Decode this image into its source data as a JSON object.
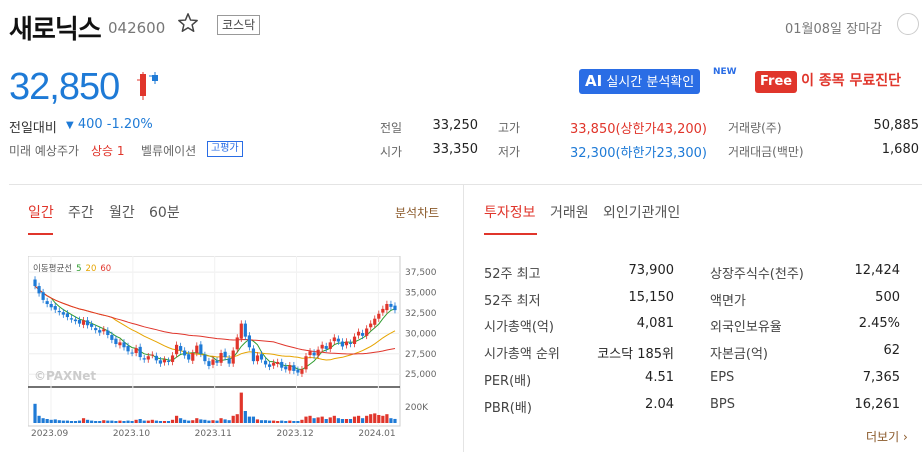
{
  "header": {
    "stock_name": "새로닉스",
    "stock_code": "042600",
    "market": "코스닥",
    "update_time": "01월08일 장마감"
  },
  "price": {
    "current": "32,850",
    "change_label": "전일대비",
    "change_arrow": "▼",
    "change_value": "400 -1.20%",
    "forecast_label": "미래 예상주가",
    "forecast_value": "상승 1",
    "valuation_label": "벨류에이션",
    "valuation_badge": "고평가"
  },
  "promos": {
    "ai_prefix": "AI",
    "ai_label": "실시간 분석확인",
    "ai_new": "NEW",
    "free_badge": "Free",
    "free_label": "이 종목 무료진단"
  },
  "quote": {
    "prev_label": "전일",
    "prev_value": "33,250",
    "open_label": "시가",
    "open_value": "33,350",
    "high_label": "고가",
    "high_value": "33,850(상한가43,200)",
    "low_label": "저가",
    "low_value": "32,300(하한가23,300)",
    "volume_label": "거래량(주)",
    "volume_value": "50,885",
    "amount_label": "거래대금(백만)",
    "amount_value": "1,680"
  },
  "chart_tabs": {
    "items": [
      "일간",
      "주간",
      "월간",
      "60분"
    ],
    "active": "일간",
    "analysis_link": "분석차트"
  },
  "info_tabs": {
    "items": [
      "투자정보",
      "거래원",
      "외인기관개인"
    ],
    "active": "투자정보"
  },
  "invest_info": {
    "left": [
      {
        "label": "52주 최고",
        "value": "73,900"
      },
      {
        "label": "52주 최저",
        "value": "15,150"
      },
      {
        "label": "시가총액(억)",
        "value": "4,081"
      },
      {
        "label": "시가총액 순위",
        "value": "코스닥 185위"
      },
      {
        "label": "PER(배)",
        "value": "4.51"
      },
      {
        "label": "PBR(배)",
        "value": "2.04"
      }
    ],
    "right": [
      {
        "label": "상장주식수(천주)",
        "value": "12,424"
      },
      {
        "label": "액면가",
        "value": "500"
      },
      {
        "label": "외국인보유율",
        "value": "2.45%"
      },
      {
        "label": "자본금(억)",
        "value": "62"
      },
      {
        "label": "EPS",
        "value": "7,365"
      },
      {
        "label": "BPS",
        "value": "16,261"
      }
    ],
    "more_link": "더보기"
  },
  "chart_data": {
    "type": "candlestick",
    "legend_title": "이동평균선",
    "ma_periods": [
      "5",
      "20",
      "60"
    ],
    "ma_colors": {
      "5": "#2e9c2e",
      "20": "#e6a400",
      "60": "#e0352b"
    },
    "up_color": "#e0352b",
    "down_color": "#1e7ad6",
    "watermark": "©PAXNet",
    "x_ticks": [
      "2023.09",
      "2023.10",
      "2023.11",
      "2023.12",
      "2024.01"
    ],
    "y_ticks": [
      "37,500",
      "35,000",
      "32,500",
      "30,000",
      "27,500",
      "25,000"
    ],
    "y_tick_values": [
      37500,
      35000,
      32500,
      30000,
      27500,
      25000
    ],
    "ylim": [
      23800,
      38500
    ],
    "volume_tick": "200K",
    "volume_tick_value": 200000,
    "volume_max": 400000,
    "close": [
      35800,
      34900,
      34100,
      33600,
      33200,
      32900,
      32600,
      32300,
      32000,
      31700,
      31500,
      31200,
      31600,
      31000,
      30800,
      30400,
      30100,
      30500,
      29800,
      29200,
      28700,
      28900,
      28300,
      27800,
      27600,
      28200,
      27100,
      26800,
      27200,
      27400,
      26700,
      26300,
      26800,
      26500,
      27300,
      28600,
      27900,
      27300,
      26800,
      27600,
      28500,
      27500,
      26600,
      26000,
      26800,
      26400,
      27600,
      27100,
      26300,
      27900,
      29500,
      31200,
      29600,
      28300,
      26600,
      27300,
      26800,
      26200,
      25900,
      26400,
      26500,
      25800,
      25600,
      26100,
      25400,
      25200,
      25600,
      27200,
      27800,
      27300,
      28000,
      28600,
      28100,
      28900,
      29500,
      29000,
      28400,
      29000,
      28700,
      29600,
      30200,
      29700,
      30600,
      31200,
      31800,
      32400,
      33000,
      33600,
      33250,
      32850
    ],
    "volume": [
      240000,
      90000,
      60000,
      50000,
      40000,
      45000,
      35000,
      30000,
      30000,
      25000,
      25000,
      30000,
      60000,
      40000,
      30000,
      25000,
      25000,
      35000,
      30000,
      30000,
      25000,
      30000,
      25000,
      30000,
      25000,
      40000,
      50000,
      30000,
      30000,
      40000,
      30000,
      25000,
      25000,
      25000,
      40000,
      90000,
      60000,
      40000,
      30000,
      35000,
      60000,
      45000,
      40000,
      30000,
      35000,
      30000,
      60000,
      45000,
      35000,
      90000,
      110000,
      380000,
      150000,
      80000,
      80000,
      45000,
      35000,
      35000,
      30000,
      30000,
      25000,
      30000,
      25000,
      30000,
      25000,
      25000,
      40000,
      80000,
      90000,
      60000,
      70000,
      80000,
      50000,
      70000,
      90000,
      60000,
      50000,
      50000,
      50000,
      80000,
      90000,
      60000,
      90000,
      110000,
      120000,
      100000,
      90000,
      110000,
      60000,
      50885
    ]
  }
}
